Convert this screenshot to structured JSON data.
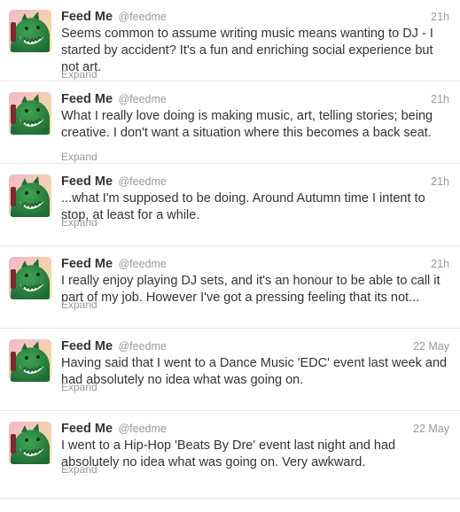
{
  "colors": {
    "accent": "#2e7d3a",
    "text": "#333333",
    "muted": "#999999",
    "divider": "#e8e8e8",
    "avatar_bg_top": "#f3b8c9",
    "avatar_bg_bottom": "#f7e3a0",
    "avatar_monster": "#1f6b35"
  },
  "tweets": [
    {
      "name": "Feed Me",
      "handle": "@feedme",
      "time": "21h",
      "text": "Seems common to assume writing music means wanting to DJ - I started by accident? It's a fun and enriching social experience but not art.",
      "expand": "Expand",
      "avatar_icon": "feed-me-monster-avatar"
    },
    {
      "name": "Feed Me",
      "handle": "@feedme",
      "time": "21h",
      "text": "What I really love doing is making music, art, telling stories; being creative. I don't want a situation where this becomes a back seat.",
      "expand": "Expand",
      "avatar_icon": "feed-me-monster-avatar"
    },
    {
      "name": "Feed Me",
      "handle": "@feedme",
      "time": "21h",
      "text": "...what I'm supposed to be doing. Around Autumn time I intent to stop, at least for a while.",
      "expand": "Expand",
      "avatar_icon": "feed-me-monster-avatar"
    },
    {
      "name": "Feed Me",
      "handle": "@feedme",
      "time": "21h",
      "text": "I really enjoy playing DJ sets, and it's an honour to be able to call it part of my job. However I've got a pressing feeling that its not...",
      "expand": "Expand",
      "avatar_icon": "feed-me-monster-avatar"
    },
    {
      "name": "Feed Me",
      "handle": "@feedme",
      "time": "22 May",
      "text": "Having said that I went to a Dance Music 'EDC' event last week and had absolutely no idea what was going on.",
      "expand": "Expand",
      "avatar_icon": "feed-me-monster-avatar"
    },
    {
      "name": "Feed Me",
      "handle": "@feedme",
      "time": "22 May",
      "text": "I went to a Hip-Hop 'Beats By Dre' event last night and had absolutely no idea what was going on. Very awkward.",
      "expand": "Expand",
      "avatar_icon": "feed-me-monster-avatar"
    }
  ]
}
